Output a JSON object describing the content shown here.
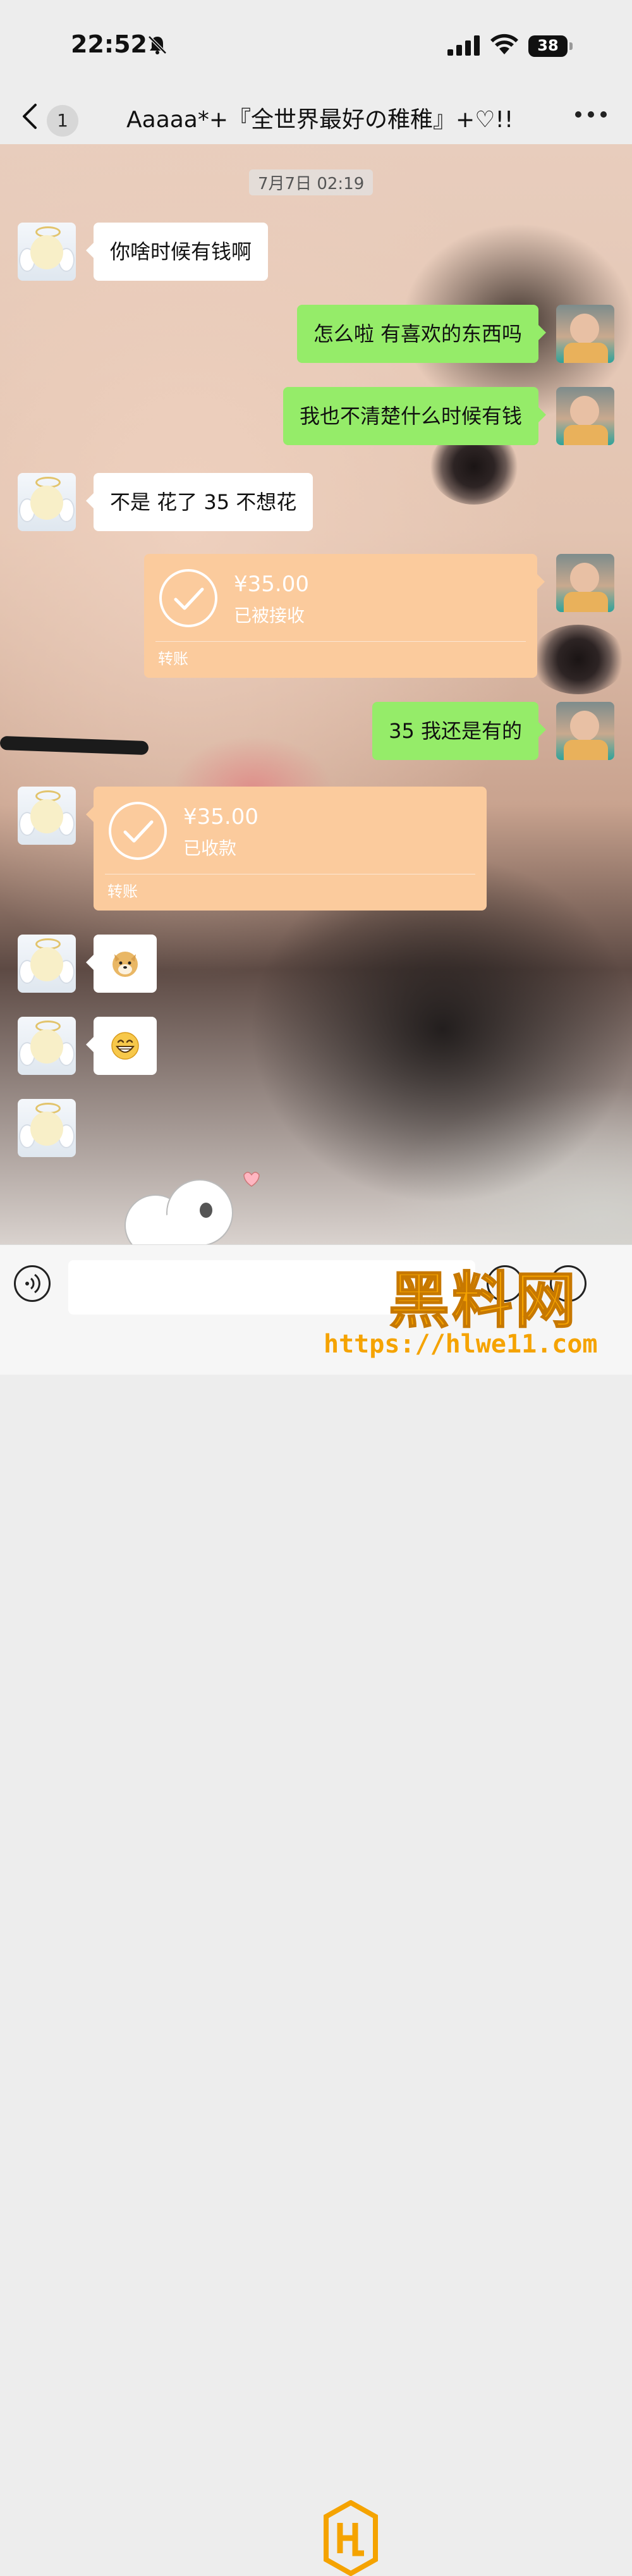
{
  "status_bar": {
    "time": "22:52",
    "battery": "38"
  },
  "nav": {
    "unread_count": "1",
    "title": "Aaaaa*+『全世界最好の稚稚』+♡!!"
  },
  "chat": {
    "timestamp": "7月7日 02:19",
    "messages": [
      {
        "side": "left",
        "type": "text",
        "text": "你啥时候有钱啊"
      },
      {
        "side": "right",
        "type": "text",
        "text": "怎么啦 有喜欢的东西吗"
      },
      {
        "side": "right",
        "type": "text",
        "text": "我也不清楚什么时候有钱"
      },
      {
        "side": "left",
        "type": "text",
        "text": "不是 花了 35 不想花"
      },
      {
        "side": "right",
        "type": "transfer",
        "amount": "¥35.00",
        "status": "已被接收",
        "kind": "转账"
      },
      {
        "side": "right",
        "type": "text",
        "text": "35 我还是有的"
      },
      {
        "side": "left",
        "type": "transfer",
        "amount": "¥35.00",
        "status": "已收款",
        "kind": "转账"
      },
      {
        "side": "left",
        "type": "sticker",
        "icon": "doge-emoji-icon"
      },
      {
        "side": "left",
        "type": "sticker",
        "icon": "grin-emoji-icon"
      }
    ]
  },
  "input_bar": {
    "placeholder": ""
  },
  "watermark": {
    "brand": "黑料网",
    "url": "https://hlwe11.com"
  },
  "colors": {
    "chat_green": "#95ec69",
    "transfer_orange": "#fbcb9d",
    "watermark_orange": "#f5a300"
  }
}
